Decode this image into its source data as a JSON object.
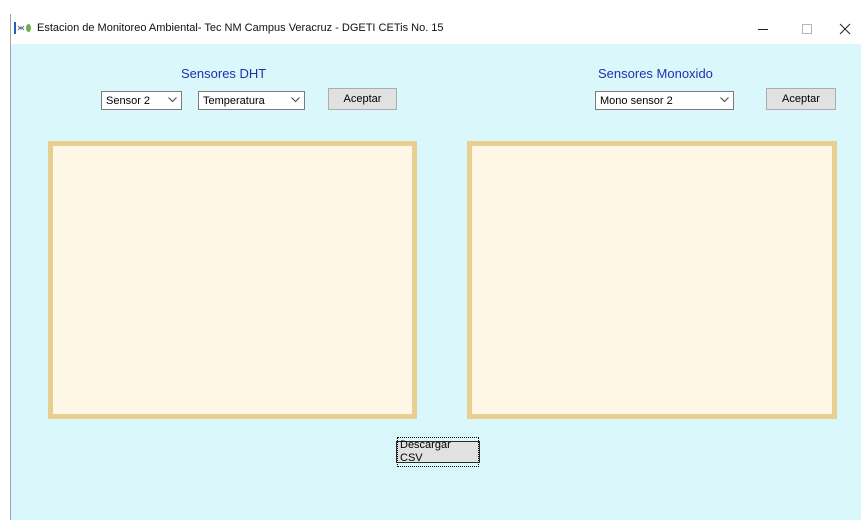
{
  "window": {
    "title": "Estacion de Monitoreo Ambiental- Tec NM Campus Veracruz - DGETI CETis No. 15",
    "icon": "app-icon"
  },
  "dht": {
    "label": "Sensores DHT",
    "sensor_select": "Sensor 2",
    "variable_select": "Temperatura",
    "accept_label": "Aceptar"
  },
  "monoxido": {
    "label": "Sensores Monoxido",
    "sensor_select": "Mono sensor 2",
    "accept_label": "Aceptar"
  },
  "download_label": "Descargar CSV",
  "colors": {
    "background": "#daf8fb",
    "panel_fill": "#fef7e6",
    "panel_border": "#e6cf91",
    "label_color": "#1f2fb0"
  }
}
